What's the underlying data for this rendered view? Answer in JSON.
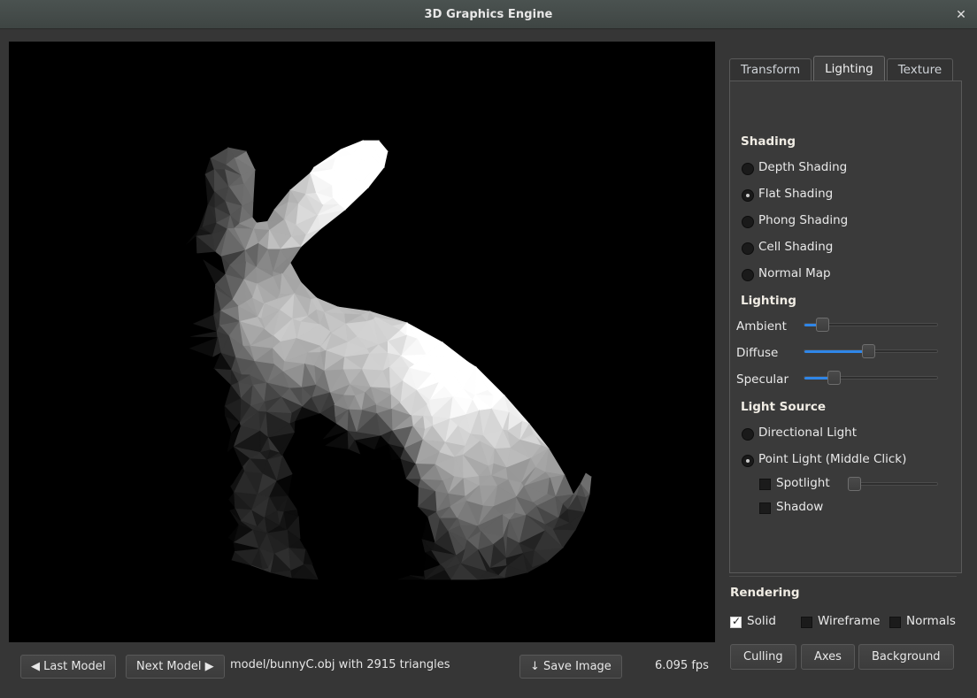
{
  "window": {
    "title": "3D Graphics Engine",
    "close_icon": "close-icon",
    "close_glyph": "✕"
  },
  "viewport": {
    "background_color": "#000000",
    "model_render": "stanford-bunny-flat-shaded"
  },
  "bottom_bar": {
    "last_model_label": "◀ Last Model",
    "next_model_label": "Next Model ▶",
    "model_info": "model/bunnyC.obj with 2915 triangles",
    "save_image_label": "↓ Save Image",
    "fps": "6.095 fps"
  },
  "tabs": [
    {
      "label": "Transform",
      "active": false
    },
    {
      "label": "Lighting",
      "active": true
    },
    {
      "label": "Texture",
      "active": false
    }
  ],
  "lighting_tab": {
    "shading": {
      "title": "Shading",
      "options": [
        {
          "label": "Depth Shading",
          "selected": false
        },
        {
          "label": "Flat Shading",
          "selected": true
        },
        {
          "label": "Phong Shading",
          "selected": false
        },
        {
          "label": "Cell Shading",
          "selected": false
        },
        {
          "label": "Normal Map",
          "selected": false
        }
      ]
    },
    "lighting": {
      "title": "Lighting",
      "sliders": [
        {
          "label": "Ambient",
          "value": 10,
          "min": 0,
          "max": 100
        },
        {
          "label": "Diffuse",
          "value": 48,
          "min": 0,
          "max": 100
        },
        {
          "label": "Specular",
          "value": 20,
          "min": 0,
          "max": 100
        }
      ]
    },
    "light_source": {
      "title": "Light Source",
      "options": [
        {
          "label": "Directional Light",
          "selected": false
        },
        {
          "label": "Point Light (Middle Click)",
          "selected": true
        }
      ],
      "sub_options": [
        {
          "label": "Spotlight",
          "checked": false
        },
        {
          "label": "Shadow",
          "checked": false
        }
      ],
      "spotlight_slider": {
        "value": 0,
        "min": 0,
        "max": 100
      }
    }
  },
  "rendering": {
    "title": "Rendering",
    "checkboxes": [
      {
        "label": "Solid",
        "checked": true
      },
      {
        "label": "Wireframe",
        "checked": false
      },
      {
        "label": "Normals",
        "checked": false
      }
    ],
    "buttons": [
      {
        "label": "Culling"
      },
      {
        "label": "Axes"
      },
      {
        "label": "Background"
      }
    ]
  },
  "colors": {
    "accent": "#2f86e8",
    "panel_bg": "#3a3a3a",
    "window_bg": "#363636",
    "titlebar": "#454c4a",
    "text": "#e9e9e9"
  }
}
